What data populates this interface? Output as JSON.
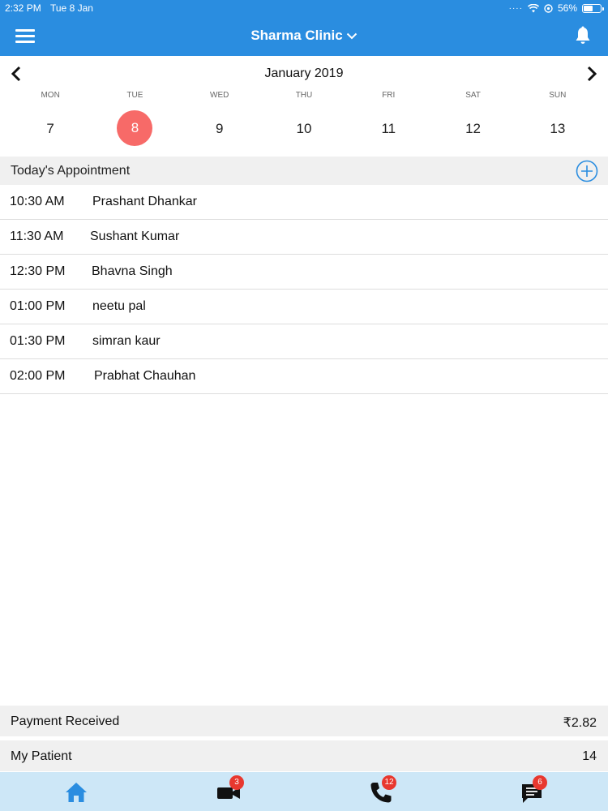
{
  "status_bar": {
    "time": "2:32 PM",
    "date": "Tue 8 Jan",
    "battery": "56%",
    "battery_level": 0.56
  },
  "header": {
    "title": "Sharma Clinic",
    "menu_icon": "hamburger-menu-icon",
    "notification_icon": "bell-icon"
  },
  "calendar": {
    "month_label": "January 2019",
    "weekdays": [
      "MON",
      "TUE",
      "WED",
      "THU",
      "FRI",
      "SAT",
      "SUN"
    ],
    "days": [
      "7",
      "8",
      "9",
      "10",
      "11",
      "12",
      "13"
    ],
    "selected_index": 1,
    "selected_color": "#f76a68"
  },
  "appointments": {
    "section_title": "Today's Appointment",
    "items": [
      {
        "time": "10:30 AM",
        "name": "Prashant Dhankar"
      },
      {
        "time": "11:30 AM",
        "name": "Sushant Kumar"
      },
      {
        "time": "12:30 PM",
        "name": "Bhavna Singh"
      },
      {
        "time": "01:00 PM",
        "name": "neetu pal"
      },
      {
        "time": "01:30 PM",
        "name": "simran kaur"
      },
      {
        "time": "02:00 PM",
        "name": "Prabhat Chauhan"
      }
    ]
  },
  "summary": {
    "payment_label": "Payment Received",
    "payment_value": "₹2.82",
    "patients_label": "My Patient",
    "patients_value": "14"
  },
  "tabs": {
    "home_icon": "home-icon",
    "video_icon": "video-call-icon",
    "video_badge": "3",
    "phone_icon": "phone-icon",
    "phone_badge": "12",
    "chat_icon": "chat-icon",
    "chat_badge": "6"
  },
  "colors": {
    "brand_blue": "#2a8de0",
    "badge_red": "#e8382f",
    "tab_bg": "#cde7f7"
  }
}
